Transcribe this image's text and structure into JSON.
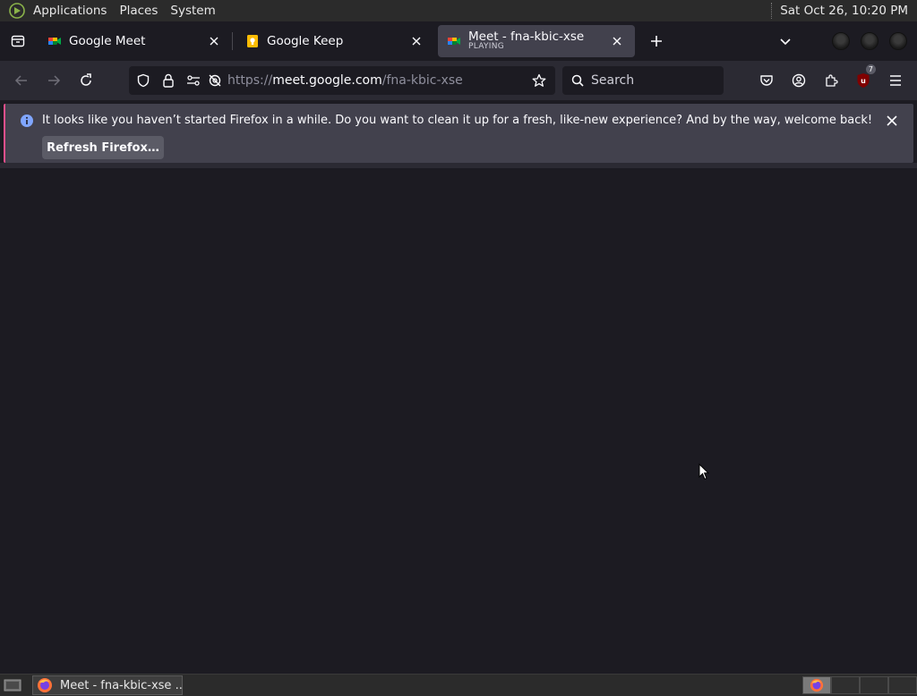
{
  "top_panel": {
    "menus": [
      "Applications",
      "Places",
      "System"
    ],
    "clock": "Sat Oct 26, 10:20 PM"
  },
  "tabs": [
    {
      "title": "Google Meet",
      "subtitle": ""
    },
    {
      "title": "Google Keep",
      "subtitle": ""
    },
    {
      "title": "Meet - fna-kbic-xse",
      "subtitle": "PLAYING",
      "active": true
    }
  ],
  "nav": {
    "url_prefix": "https://",
    "url_host": "meet.google.com",
    "url_path": "/fna-kbic-xse",
    "search_placeholder": "Search",
    "extension_badge": "7"
  },
  "notification": {
    "message": "It looks like you haven’t started Firefox in a while. Do you want to clean it up for a fresh, like-new experience? And by the way, welcome back!",
    "button_label": "Refresh Firefox…"
  },
  "taskbar": {
    "task_label": "Meet - fna-kbic-xse ..."
  },
  "colors": {
    "content_bg": "#1c1b22",
    "toolbar_bg": "#2b2a33",
    "notification_bg": "#42414d",
    "accent_info": "#80ebff"
  }
}
